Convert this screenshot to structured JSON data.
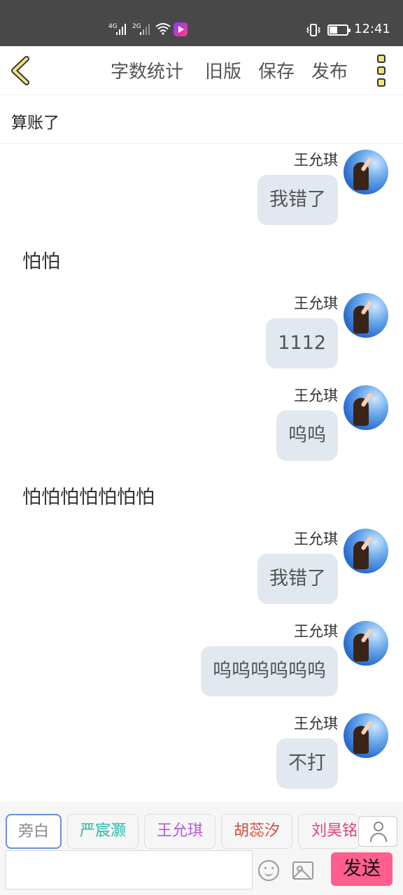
{
  "status_bar": {
    "network_1": "4G",
    "network_2": "2G",
    "time": "12:41"
  },
  "toolbar": {
    "word_count": "字数统计",
    "old_version": "旧版",
    "save": "保存",
    "publish": "发布"
  },
  "story_title": "算账了",
  "messages": [
    {
      "name": "王允琪",
      "text": "我错了"
    },
    {
      "narration": "怕怕"
    },
    {
      "name": "王允琪",
      "text": "1112"
    },
    {
      "name": "王允琪",
      "text": "呜呜"
    },
    {
      "narration": "怕怕怕怕怕怕怕"
    },
    {
      "name": "王允琪",
      "text": "我错了"
    },
    {
      "name": "王允琪",
      "text": "呜呜呜呜呜呜"
    },
    {
      "name": "王允琪",
      "text": "不打"
    }
  ],
  "characters": [
    {
      "label": "旁白",
      "color": "#888888"
    },
    {
      "label": "严宸灏",
      "color": "#2bb5a8"
    },
    {
      "label": "王允琪",
      "color": "#b35ad8"
    },
    {
      "label": "胡蕊汐",
      "color": "#d94a3a"
    },
    {
      "label": "刘昊铭",
      "color": "#e0437e"
    }
  ],
  "composer": {
    "send_label": "发送"
  },
  "icons": {
    "back": "chevron-left-icon",
    "more": "more-vertical-icon",
    "emoji": "smiley-icon",
    "image": "image-icon",
    "person": "person-icon"
  }
}
